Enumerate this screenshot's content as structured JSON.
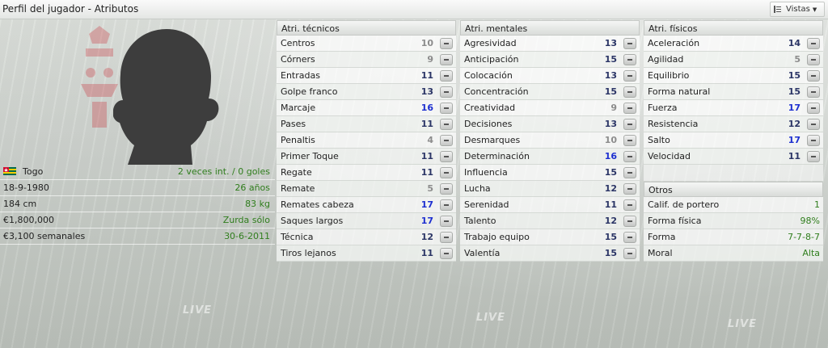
{
  "window": {
    "title": "Perfil del jugador - Atributos",
    "views_label": "Vistas"
  },
  "player": {
    "nationality": "Togo",
    "international": "2 veces int. / 0 goles",
    "birth_date": "18-9-1980",
    "age": "26 años",
    "height": "184 cm",
    "weight": "83 kg",
    "value": "€1,800,000",
    "foot": "Zurda sólo",
    "wage": "€3,100 semanales",
    "contract_end": "30-6-2011"
  },
  "technical": {
    "header": "Atri. técnicos",
    "items": [
      {
        "name": "Centros",
        "value": "10",
        "tone": "grey"
      },
      {
        "name": "Córners",
        "value": "9",
        "tone": "grey"
      },
      {
        "name": "Entradas",
        "value": "11",
        "tone": "dark"
      },
      {
        "name": "Golpe franco",
        "value": "13",
        "tone": "dark"
      },
      {
        "name": "Marcaje",
        "value": "16",
        "tone": "blue"
      },
      {
        "name": "Pases",
        "value": "11",
        "tone": "dark"
      },
      {
        "name": "Penaltis",
        "value": "4",
        "tone": "grey"
      },
      {
        "name": "Primer Toque",
        "value": "11",
        "tone": "dark"
      },
      {
        "name": "Regate",
        "value": "11",
        "tone": "dark"
      },
      {
        "name": "Remate",
        "value": "5",
        "tone": "grey"
      },
      {
        "name": "Remates cabeza",
        "value": "17",
        "tone": "blue"
      },
      {
        "name": "Saques largos",
        "value": "17",
        "tone": "blue"
      },
      {
        "name": "Técnica",
        "value": "12",
        "tone": "dark"
      },
      {
        "name": "Tiros lejanos",
        "value": "11",
        "tone": "dark"
      }
    ]
  },
  "mental": {
    "header": "Atri. mentales",
    "items": [
      {
        "name": "Agresividad",
        "value": "13",
        "tone": "dark"
      },
      {
        "name": "Anticipación",
        "value": "15",
        "tone": "dark"
      },
      {
        "name": "Colocación",
        "value": "13",
        "tone": "dark"
      },
      {
        "name": "Concentración",
        "value": "15",
        "tone": "dark"
      },
      {
        "name": "Creatividad",
        "value": "9",
        "tone": "grey"
      },
      {
        "name": "Decisiones",
        "value": "13",
        "tone": "dark"
      },
      {
        "name": "Desmarques",
        "value": "10",
        "tone": "grey"
      },
      {
        "name": "Determinación",
        "value": "16",
        "tone": "blue"
      },
      {
        "name": "Influencia",
        "value": "15",
        "tone": "dark"
      },
      {
        "name": "Lucha",
        "value": "12",
        "tone": "dark"
      },
      {
        "name": "Serenidad",
        "value": "11",
        "tone": "dark"
      },
      {
        "name": "Talento",
        "value": "12",
        "tone": "dark"
      },
      {
        "name": "Trabajo equipo",
        "value": "15",
        "tone": "dark"
      },
      {
        "name": "Valentía",
        "value": "15",
        "tone": "dark"
      }
    ]
  },
  "physical": {
    "header": "Atri. físicos",
    "items": [
      {
        "name": "Aceleración",
        "value": "14",
        "tone": "dark"
      },
      {
        "name": "Agilidad",
        "value": "5",
        "tone": "grey"
      },
      {
        "name": "Equilibrio",
        "value": "15",
        "tone": "dark"
      },
      {
        "name": "Forma natural",
        "value": "15",
        "tone": "dark"
      },
      {
        "name": "Fuerza",
        "value": "17",
        "tone": "blue"
      },
      {
        "name": "Resistencia",
        "value": "12",
        "tone": "dark"
      },
      {
        "name": "Salto",
        "value": "17",
        "tone": "blue"
      },
      {
        "name": "Velocidad",
        "value": "11",
        "tone": "dark"
      }
    ]
  },
  "others": {
    "header": "Otros",
    "items": [
      {
        "name": "Calif. de portero",
        "value": "1"
      },
      {
        "name": "Forma física",
        "value": "98%"
      },
      {
        "name": "Forma",
        "value": "7-7-8-7"
      },
      {
        "name": "Moral",
        "value": "Alta"
      }
    ]
  },
  "background": {
    "watermark": "LIVE"
  },
  "colors": {
    "value_high": "#1d2fd0",
    "value_mid": "#2b3566",
    "value_low": "#8c8c8c",
    "positive_text": "#2f7d1c"
  },
  "icons": {
    "views": "list-lines-icon",
    "row_action": "minus-icon",
    "flag": "togo-flag-icon",
    "silhouette": "player-silhouette"
  }
}
